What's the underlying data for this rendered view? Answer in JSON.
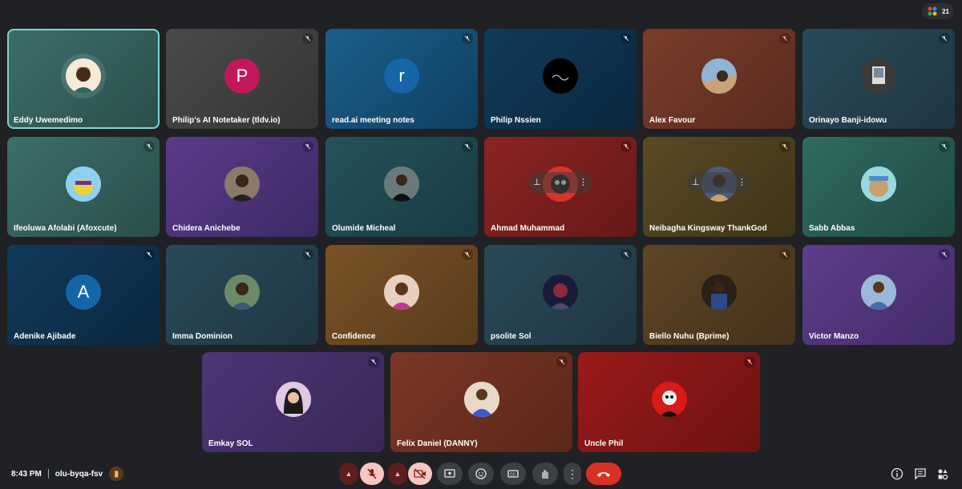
{
  "meeting": {
    "time": "8:43 PM",
    "code": "olu-byqa-fsv",
    "participant_count": "21"
  },
  "participants": [
    {
      "name": "Eddy Uwemedimo",
      "initial": ""
    },
    {
      "name": "Philip's AI Notetaker (tldv.io)",
      "initial": "P"
    },
    {
      "name": "read.ai meeting notes",
      "initial": "r"
    },
    {
      "name": "Philip Nssien",
      "initial": ""
    },
    {
      "name": "Alex Favour",
      "initial": ""
    },
    {
      "name": "Orinayo Banji-idowu",
      "initial": ""
    },
    {
      "name": "Ifeoluwa Afolabi (Afoxcute)",
      "initial": ""
    },
    {
      "name": "Chidera Anichebe",
      "initial": ""
    },
    {
      "name": "Olumide Micheal",
      "initial": ""
    },
    {
      "name": "Ahmad Muhammad",
      "initial": ""
    },
    {
      "name": "Neibagha Kingsway ThankGod",
      "initial": ""
    },
    {
      "name": "Sabb Abbas",
      "initial": ""
    },
    {
      "name": "Adenike Ajibade",
      "initial": "A"
    },
    {
      "name": "Imma Dominion",
      "initial": ""
    },
    {
      "name": "Confidence",
      "initial": ""
    },
    {
      "name": "psolite Sol",
      "initial": ""
    },
    {
      "name": "Biello Nuhu (Bprime)",
      "initial": ""
    },
    {
      "name": "Victor Manzo",
      "initial": ""
    },
    {
      "name": "Emkay SOL",
      "initial": ""
    },
    {
      "name": "Felix Daniel (DANNY)",
      "initial": ""
    },
    {
      "name": "Uncle Phil",
      "initial": ""
    }
  ],
  "icons": {
    "mic_off": "mic-off-icon",
    "camera_off": "camera-off-icon",
    "present": "present-icon",
    "emoji": "emoji-icon",
    "captions": "captions-icon",
    "raise_hand": "raise-hand-icon",
    "more": "more-options-icon",
    "end_call": "end-call-icon",
    "info": "info-icon",
    "chat": "chat-icon",
    "people": "people-icon"
  },
  "colors": {
    "background": "#202124",
    "end_call": "#d93025",
    "active_border": "#7fd3d6"
  }
}
